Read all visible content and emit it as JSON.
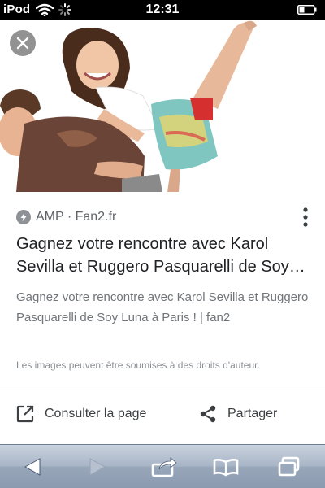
{
  "status_bar": {
    "carrier": "iPod",
    "time": "12:31"
  },
  "icons": {
    "wifi": "wifi-icon",
    "loading": "activity-spinner-icon",
    "battery": "battery-icon",
    "close": "close-icon",
    "amp": "amp-lightning-icon",
    "more": "more-vertical-icon",
    "open": "open-in-new-icon",
    "share": "share-icon",
    "back": "back-arrow-icon",
    "forward": "forward-arrow-icon",
    "action": "action-share-icon",
    "bookmarks": "bookmarks-icon",
    "pages": "pages-icon"
  },
  "card": {
    "source": "AMP · Fan2.fr",
    "title": "Gagnez votre rencontre avec Karol Sevilla et Ruggero Pasquarelli de Soy Luna à Paris !",
    "snippet": "Gagnez votre rencontre avec Karol Sevilla et Ruggero Pasquarelli de Soy Luna à Paris ! | fan2",
    "copyright_notice": "Les images peuvent être soumises à des droits d'auteur."
  },
  "actions": {
    "open_label": "Consulter la page",
    "share_label": "Partager"
  },
  "colors": {
    "text_primary": "#202124",
    "text_secondary": "#70757a",
    "toolbar_top": "#c9d2de",
    "toolbar_bottom": "#8b9ab0"
  }
}
